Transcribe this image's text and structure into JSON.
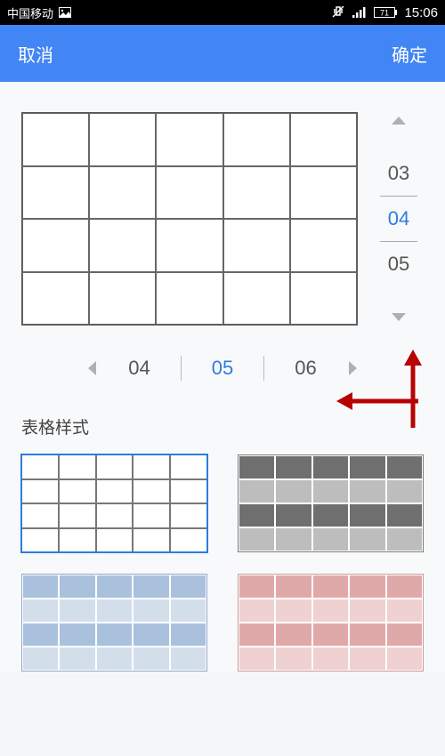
{
  "status": {
    "carrier": "中国移动",
    "battery": "71",
    "time": "15:06"
  },
  "header": {
    "cancel": "取消",
    "confirm": "确定"
  },
  "vpicker": {
    "prev": "03",
    "current": "04",
    "next": "05"
  },
  "hpicker": {
    "prev": "04",
    "current": "05",
    "next": "06"
  },
  "section": {
    "style_title": "表格样式"
  }
}
